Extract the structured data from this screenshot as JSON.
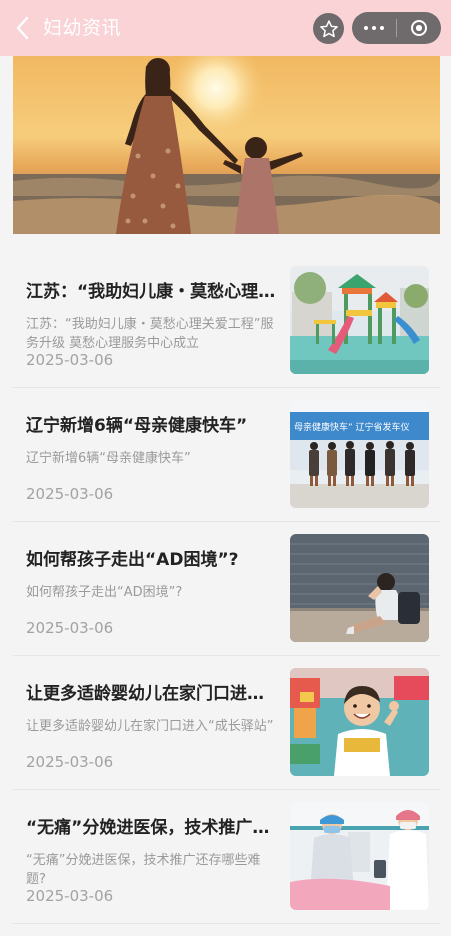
{
  "header": {
    "title": "妇幼资讯"
  },
  "articles": [
    {
      "title": "江苏：“我助妇儿康・莫愁心理关爱工程”服务升级 莫愁心理服务中心成立",
      "summary": "江苏：“我助妇儿康・莫愁心理关爱工程”服务升级 莫愁心理服务中心成立",
      "date": "2025-03-06",
      "thumb": "playground"
    },
    {
      "title": "辽宁新增6辆“母亲健康快车”",
      "summary": "辽宁新增6辆“母亲健康快车”",
      "date": "2025-03-06",
      "thumb": "ceremony",
      "thumb_text": "母亲健康快车” 辽宁省发车仪"
    },
    {
      "title": "如何帮孩子走出“AD困境”?",
      "summary": "如何帮孩子走出“AD困境”?",
      "date": "2025-03-06",
      "thumb": "sad-child"
    },
    {
      "title": "让更多适龄婴幼儿在家门口进入“成长驿站”",
      "summary": "让更多适龄婴幼儿在家门口进入“成长驿站”",
      "date": "2025-03-06",
      "thumb": "smiling-child"
    },
    {
      "title": "“无痛”分娩进医保，技术推广还存哪些难题?",
      "summary": "“无痛”分娩进医保，技术推广还存哪些难题?",
      "date": "2025-03-06",
      "thumb": "hospital"
    }
  ],
  "colors": {
    "header_bg": "#f9d3d6",
    "capsule_bg": "#6f6a6b",
    "page_bg": "#f4f4f4"
  },
  "icons": [
    "back-icon",
    "star-icon",
    "more-icon",
    "close-circle-icon"
  ]
}
